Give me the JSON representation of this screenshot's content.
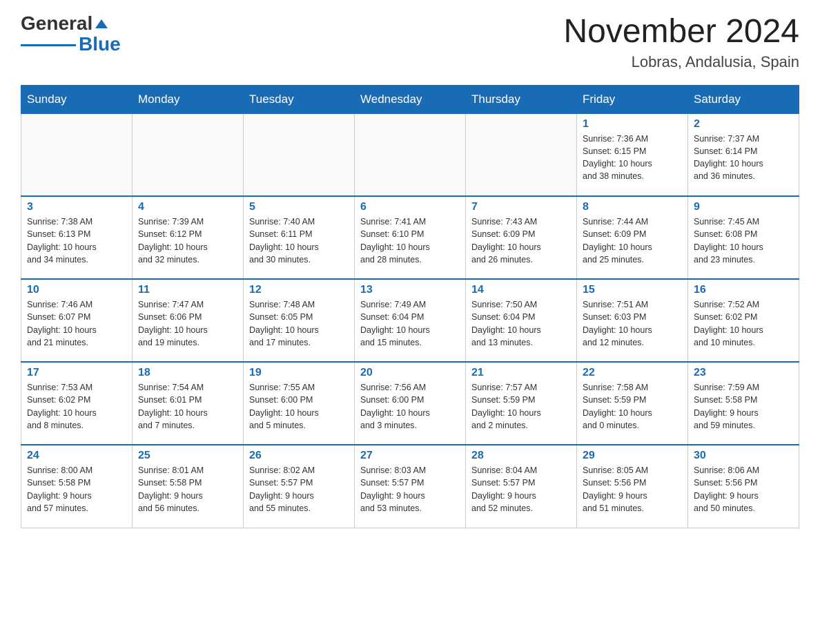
{
  "header": {
    "logo_general": "General",
    "logo_blue": "Blue",
    "month_year": "November 2024",
    "location": "Lobras, Andalusia, Spain"
  },
  "days_of_week": [
    "Sunday",
    "Monday",
    "Tuesday",
    "Wednesday",
    "Thursday",
    "Friday",
    "Saturday"
  ],
  "weeks": [
    {
      "days": [
        {
          "number": "",
          "info": ""
        },
        {
          "number": "",
          "info": ""
        },
        {
          "number": "",
          "info": ""
        },
        {
          "number": "",
          "info": ""
        },
        {
          "number": "",
          "info": ""
        },
        {
          "number": "1",
          "info": "Sunrise: 7:36 AM\nSunset: 6:15 PM\nDaylight: 10 hours\nand 38 minutes."
        },
        {
          "number": "2",
          "info": "Sunrise: 7:37 AM\nSunset: 6:14 PM\nDaylight: 10 hours\nand 36 minutes."
        }
      ]
    },
    {
      "days": [
        {
          "number": "3",
          "info": "Sunrise: 7:38 AM\nSunset: 6:13 PM\nDaylight: 10 hours\nand 34 minutes."
        },
        {
          "number": "4",
          "info": "Sunrise: 7:39 AM\nSunset: 6:12 PM\nDaylight: 10 hours\nand 32 minutes."
        },
        {
          "number": "5",
          "info": "Sunrise: 7:40 AM\nSunset: 6:11 PM\nDaylight: 10 hours\nand 30 minutes."
        },
        {
          "number": "6",
          "info": "Sunrise: 7:41 AM\nSunset: 6:10 PM\nDaylight: 10 hours\nand 28 minutes."
        },
        {
          "number": "7",
          "info": "Sunrise: 7:43 AM\nSunset: 6:09 PM\nDaylight: 10 hours\nand 26 minutes."
        },
        {
          "number": "8",
          "info": "Sunrise: 7:44 AM\nSunset: 6:09 PM\nDaylight: 10 hours\nand 25 minutes."
        },
        {
          "number": "9",
          "info": "Sunrise: 7:45 AM\nSunset: 6:08 PM\nDaylight: 10 hours\nand 23 minutes."
        }
      ]
    },
    {
      "days": [
        {
          "number": "10",
          "info": "Sunrise: 7:46 AM\nSunset: 6:07 PM\nDaylight: 10 hours\nand 21 minutes."
        },
        {
          "number": "11",
          "info": "Sunrise: 7:47 AM\nSunset: 6:06 PM\nDaylight: 10 hours\nand 19 minutes."
        },
        {
          "number": "12",
          "info": "Sunrise: 7:48 AM\nSunset: 6:05 PM\nDaylight: 10 hours\nand 17 minutes."
        },
        {
          "number": "13",
          "info": "Sunrise: 7:49 AM\nSunset: 6:04 PM\nDaylight: 10 hours\nand 15 minutes."
        },
        {
          "number": "14",
          "info": "Sunrise: 7:50 AM\nSunset: 6:04 PM\nDaylight: 10 hours\nand 13 minutes."
        },
        {
          "number": "15",
          "info": "Sunrise: 7:51 AM\nSunset: 6:03 PM\nDaylight: 10 hours\nand 12 minutes."
        },
        {
          "number": "16",
          "info": "Sunrise: 7:52 AM\nSunset: 6:02 PM\nDaylight: 10 hours\nand 10 minutes."
        }
      ]
    },
    {
      "days": [
        {
          "number": "17",
          "info": "Sunrise: 7:53 AM\nSunset: 6:02 PM\nDaylight: 10 hours\nand 8 minutes."
        },
        {
          "number": "18",
          "info": "Sunrise: 7:54 AM\nSunset: 6:01 PM\nDaylight: 10 hours\nand 7 minutes."
        },
        {
          "number": "19",
          "info": "Sunrise: 7:55 AM\nSunset: 6:00 PM\nDaylight: 10 hours\nand 5 minutes."
        },
        {
          "number": "20",
          "info": "Sunrise: 7:56 AM\nSunset: 6:00 PM\nDaylight: 10 hours\nand 3 minutes."
        },
        {
          "number": "21",
          "info": "Sunrise: 7:57 AM\nSunset: 5:59 PM\nDaylight: 10 hours\nand 2 minutes."
        },
        {
          "number": "22",
          "info": "Sunrise: 7:58 AM\nSunset: 5:59 PM\nDaylight: 10 hours\nand 0 minutes."
        },
        {
          "number": "23",
          "info": "Sunrise: 7:59 AM\nSunset: 5:58 PM\nDaylight: 9 hours\nand 59 minutes."
        }
      ]
    },
    {
      "days": [
        {
          "number": "24",
          "info": "Sunrise: 8:00 AM\nSunset: 5:58 PM\nDaylight: 9 hours\nand 57 minutes."
        },
        {
          "number": "25",
          "info": "Sunrise: 8:01 AM\nSunset: 5:58 PM\nDaylight: 9 hours\nand 56 minutes."
        },
        {
          "number": "26",
          "info": "Sunrise: 8:02 AM\nSunset: 5:57 PM\nDaylight: 9 hours\nand 55 minutes."
        },
        {
          "number": "27",
          "info": "Sunrise: 8:03 AM\nSunset: 5:57 PM\nDaylight: 9 hours\nand 53 minutes."
        },
        {
          "number": "28",
          "info": "Sunrise: 8:04 AM\nSunset: 5:57 PM\nDaylight: 9 hours\nand 52 minutes."
        },
        {
          "number": "29",
          "info": "Sunrise: 8:05 AM\nSunset: 5:56 PM\nDaylight: 9 hours\nand 51 minutes."
        },
        {
          "number": "30",
          "info": "Sunrise: 8:06 AM\nSunset: 5:56 PM\nDaylight: 9 hours\nand 50 minutes."
        }
      ]
    }
  ]
}
